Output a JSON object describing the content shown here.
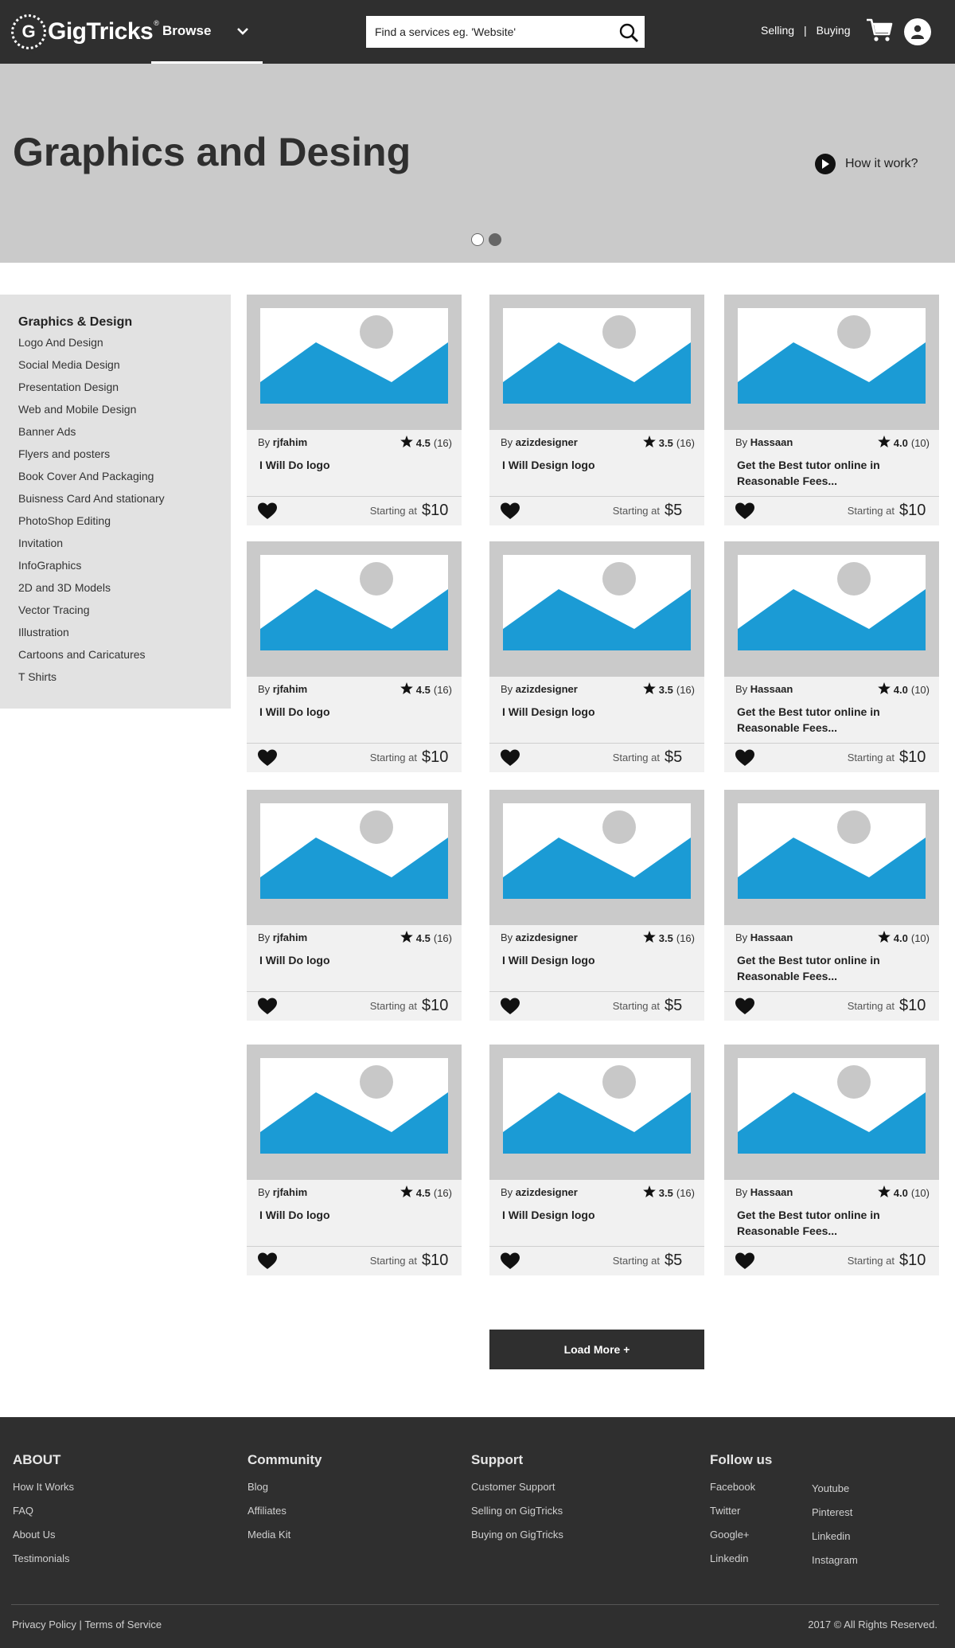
{
  "header": {
    "logo_text": "GigTricks",
    "logo_reg": "®",
    "browse_label": "Browse",
    "search_placeholder": "Find a services eg. 'Website'",
    "selling_label": "Selling",
    "separator": "|",
    "buying_label": "Buying",
    "icons": [
      "chevron-down-icon",
      "search-icon",
      "cart-icon",
      "user-icon"
    ]
  },
  "hero": {
    "title": "Graphics and Desing",
    "how_label": "How it work?",
    "slide_count": 2,
    "active_slide": 1
  },
  "sidebar": {
    "title": "Graphics & Design",
    "items": [
      "Logo And Design",
      "Social Media Design",
      "Presentation Design",
      "Web and Mobile Design",
      "Banner Ads",
      "Flyers and posters",
      "Book Cover And Packaging",
      "Buisness Card And stationary",
      "PhotoShop Editing",
      "Invitation",
      "InfoGraphics",
      "2D and 3D Models",
      "Vector Tracing",
      "Illustration",
      "Cartoons and Caricatures",
      "T Shirts"
    ]
  },
  "gigs": {
    "by_prefix": "By",
    "starting_label": "Starting at",
    "rows": [
      [
        {
          "seller": "rjfahim",
          "rating": "4.5",
          "reviews": "(16)",
          "title": "I Will Do logo",
          "price": "$10"
        },
        {
          "seller": "azizdesigner",
          "rating": "3.5",
          "reviews": "(16)",
          "title": "I Will Design logo",
          "price": "$5"
        },
        {
          "seller": "Hassaan",
          "rating": "4.0",
          "reviews": "(10)",
          "title": "Get the Best tutor online in Reasonable Fees...",
          "price": "$10"
        }
      ],
      [
        {
          "seller": "rjfahim",
          "rating": "4.5",
          "reviews": "(16)",
          "title": "I Will Do logo",
          "price": "$10"
        },
        {
          "seller": "azizdesigner",
          "rating": "3.5",
          "reviews": "(16)",
          "title": "I Will Design logo",
          "price": "$5"
        },
        {
          "seller": "Hassaan",
          "rating": "4.0",
          "reviews": "(10)",
          "title": "Get the Best tutor online in Reasonable Fees...",
          "price": "$10"
        }
      ],
      [
        {
          "seller": "rjfahim",
          "rating": "4.5",
          "reviews": "(16)",
          "title": "I Will Do logo",
          "price": "$10"
        },
        {
          "seller": "azizdesigner",
          "rating": "3.5",
          "reviews": "(16)",
          "title": "I Will Design logo",
          "price": "$5"
        },
        {
          "seller": "Hassaan",
          "rating": "4.0",
          "reviews": "(10)",
          "title": "Get the Best tutor online in Reasonable Fees...",
          "price": "$10"
        }
      ],
      [
        {
          "seller": "rjfahim",
          "rating": "4.5",
          "reviews": "(16)",
          "title": "I Will Do logo",
          "price": "$10"
        },
        {
          "seller": "azizdesigner",
          "rating": "3.5",
          "reviews": "(16)",
          "title": "I Will Design logo",
          "price": "$5"
        },
        {
          "seller": "Hassaan",
          "rating": "4.0",
          "reviews": "(10)",
          "title": "Get the Best tutor online in Reasonable Fees...",
          "price": "$10"
        }
      ]
    ]
  },
  "load_more_label": "Load More +",
  "footer": {
    "about": {
      "title": "ABOUT",
      "links": [
        "How It Works",
        "FAQ",
        "About Us",
        "Testimonials"
      ]
    },
    "community": {
      "title": "Community",
      "links": [
        "Blog",
        "Affiliates",
        "Media Kit"
      ]
    },
    "support": {
      "title": "Support",
      "links": [
        "Customer Support",
        "Selling on GigTricks",
        "Buying on GigTricks"
      ]
    },
    "follow": {
      "title": "Follow us",
      "col1": [
        "Facebook",
        "Twitter",
        "Google+",
        "Linkedin"
      ],
      "col2": [
        "Youtube",
        "Pinterest",
        "Linkedin",
        "Instagram"
      ]
    },
    "privacy": "Privacy Policy",
    "separator": "|",
    "terms": "Terms of Service",
    "copyright": "2017 © All Rights Reserved."
  },
  "colors": {
    "header_bg": "#2f2f2f",
    "hero_bg": "#cacaca",
    "sidebar_bg": "#e2e2e2",
    "card_bg": "#f1f1f1",
    "thumb_blue": "#1b9bd5"
  }
}
